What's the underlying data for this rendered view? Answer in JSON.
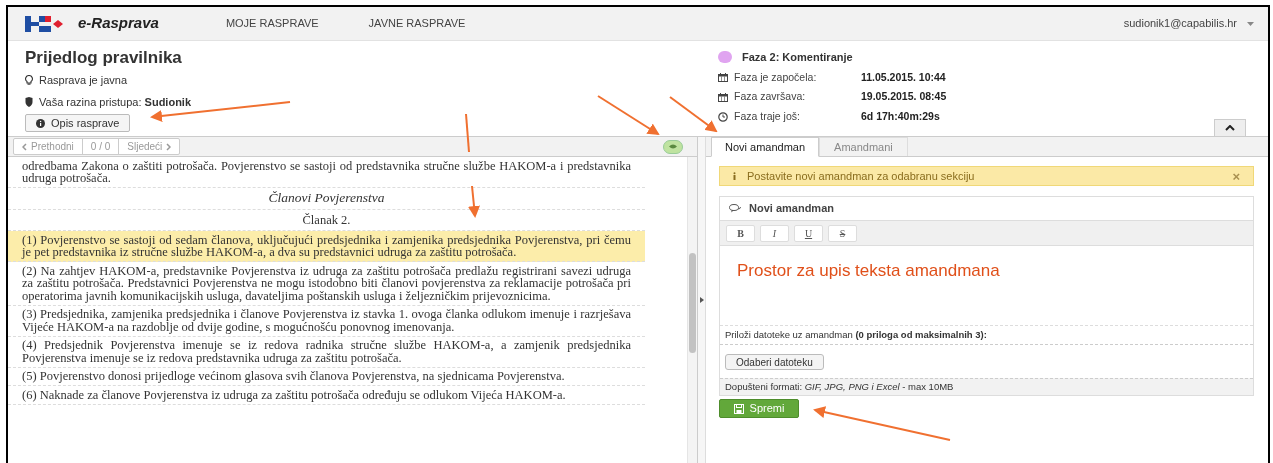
{
  "header": {
    "logo_text": "e-Rasprava",
    "nav": [
      {
        "label": "MOJE RASPRAVE",
        "selected": false
      },
      {
        "label": "JAVNE RASPRAVE",
        "selected": false
      }
    ],
    "user": "sudionik1@capabilis.hr"
  },
  "discussion": {
    "title": "Prijedlog pravilnika",
    "visibility": "Rasprava je javna",
    "access": "Vaša razina pristupa: **Sudionik**",
    "description_button": "Opis rasprave"
  },
  "phase": {
    "name": "Faza 2: Komentiranje",
    "color": "#e0a4f0",
    "rows": [
      {
        "kind": "calendar",
        "label": "Faza je započela:",
        "value": "11.05.2015. 10:44"
      },
      {
        "kind": "calendar",
        "label": "Faza završava:",
        "value": "19.05.2015. 08:45"
      },
      {
        "kind": "clock",
        "label": "Faza traje još:",
        "value": "6d 17h:40m:29s"
      }
    ]
  },
  "pager": {
    "previous": "Prethodni",
    "count": "0 / 0",
    "next": "Sljedeći"
  },
  "document": [
    {
      "kind": "paragraph",
      "selected": false,
      "text": "odredbama Zakona o zaštiti potrošača. Povjerenstvo se sastoji od predstavnika stručne službe HAKOM-a i predstavnika udruga potrošača."
    },
    {
      "kind": "heading",
      "selected": false,
      "text": "Članovi Povjerenstva"
    },
    {
      "kind": "article",
      "selected": false,
      "text": "Članak 2."
    },
    {
      "kind": "paragraph",
      "selected": true,
      "text": "(1) Povjerenstvo se sastoji od sedam članova, uključujući predsjednika i zamjenika predsjednika Povjerenstva, pri čemu je pet predstavnika iz stručne službe HAKOM-a, a dva su predstavnici udruga za zaštitu potrošača."
    },
    {
      "kind": "paragraph",
      "selected": false,
      "text": "(2) Na zahtjev HAKOM-a, predstavnike Povjerenstva iz udruga za zaštitu potrošača predlažu registrirani savezi udruga za zaštitu potrošača. Predstavnici Povjerenstva ne mogu istodobno biti članovi povjerenstva za reklamacije potrošača pri operatorima javnih komunikacijskih usluga, davateljima poštanskih usluga i željezničkim prijevoznicima."
    },
    {
      "kind": "paragraph",
      "selected": false,
      "text": "(3) Predsjednika, zamjenika predsjednika i članove Povjerenstva iz stavka 1. ovoga članka odlukom imenuje i razrješava Vijeće HAKOM-a na razdoblje od dvije godine, s mogućnošću ponovnog imenovanja."
    },
    {
      "kind": "paragraph",
      "selected": false,
      "text": "(4) Predsjednik Povjerenstva imenuje se iz redova radnika stručne službe HAKOM-a, a zamjenik predsjednika Povjerenstva imenuje se iz redova predstavnika udruga za zaštitu potrošača."
    },
    {
      "kind": "paragraph",
      "selected": false,
      "text": "(5) Povjerenstvo donosi prijedloge većinom glasova svih članova Povjerenstva, na sjednicama Povjerenstva."
    },
    {
      "kind": "paragraph",
      "selected": false,
      "text": "(6) Naknade za članove Povjerenstva iz udruga za zaštitu potrošača određuju se odlukom Vijeća HAKOM-a."
    }
  ],
  "tabs": [
    {
      "label": "Novi amandman",
      "selected": true
    },
    {
      "label": "Amandmani",
      "selected": false
    }
  ],
  "alert": {
    "text": "Postavite novi amandman za odabranu sekciju",
    "close": "×"
  },
  "amendment": {
    "title": "Novi amandman",
    "format_buttons": [
      {
        "kind": "bold",
        "label": "B"
      },
      {
        "kind": "italic",
        "label": "I"
      },
      {
        "kind": "underline",
        "label": "U"
      },
      {
        "kind": "strike",
        "label": "S"
      }
    ],
    "editor_value": "Prostor za upis teksta amandmana",
    "attach_label": "Priloži datoteke uz amandman **(0 priloga od maksimalnih 3):**",
    "file_button": "Odaberi datoteku",
    "formats": "Dopušteni formati: *GIF, JPG, PNG i Excel* - max 10MB"
  },
  "save_button": "Spremi"
}
